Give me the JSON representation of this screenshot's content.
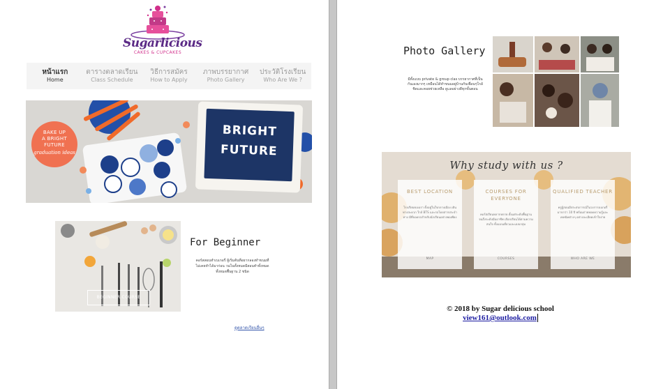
{
  "logo": {
    "word": "Sugarlicious",
    "tagline": "CAKES & CUPCAKES"
  },
  "nav": [
    {
      "th": "หน้าแรก",
      "en": "Home",
      "active": true
    },
    {
      "th": "ตารางตลาดเรียน",
      "en": "Class Schedule"
    },
    {
      "th": "วิธีการสมัคร",
      "en": "How to Apply"
    },
    {
      "th": "ภาพบรรยากาศ",
      "en": "Photo Gallery"
    },
    {
      "th": "ประวัติโรงเรียน",
      "en": "Who Are We ?"
    }
  ],
  "hero": {
    "bubble_line1": "BAKE UP",
    "bubble_line2": "A BRIGHT",
    "bubble_line3": "FUTURE",
    "bubble_script": "graduation ideas",
    "board_line1": "BRIGHT",
    "board_line2": "FUTURE"
  },
  "beginner": {
    "title": "For Beginner",
    "desc": "คอร์สสอนทำเบเกอรี่ ผู้เริ่มต้นที่อยากลองทำขนมที่ไม่เคยทำได้มาก่อน วนในทั้งหมดมีสอนทำทั้งหมดทั้งหมดพื้นฐาน 2 ชนิด",
    "button": "BEGINNER COURSE",
    "more_link": "ดูตลาดเรียนอื่นๆ"
  },
  "gallery": {
    "title": "Photo Gallery",
    "desc": "มีทั้งแบบ private & group clas บรรยากาศที่เป็นกันเองมากๆ เหมือนได้ทำขนมอยู่บ้านกับเพื่อนๆใกล้ชิดและคอยช่วยเหลือ ดูแลอย่างดีทุกขั้นตอน"
  },
  "why": {
    "title": "Why study with us ?",
    "cards": [
      {
        "title": "BEST LOCATION",
        "desc": "โรงเรียนของเรา ตั้งอยู่ในใจกลางเมือง เดินทางสะดวก ใกล้ BTS และรถโดยสารประจำทาง มีที่จอดรถสำหรับนักเรียนอย่างพอเพียง",
        "bottom": "MAP"
      },
      {
        "title": "COURSES FOR EVERYONE",
        "desc": "คอร์สเรียนหลากหลาย ตั้งแต่ระดับพื้นฐานจนถึงระดับมืออาชีพ เลือกเรียนได้ตามความสนใจ ทั้งแบบเดี่ยวและแบบกลุ่ม",
        "bottom": "COURSES"
      },
      {
        "title": "QUALIFIED TEACHER",
        "desc": "ครูผู้สอนมีประสบการณ์ในวงการเบเกอรี่มากกว่า 10 ปี พร้อมถ่ายทอดความรู้และเทคนิคต่างๆ อย่างละเอียดเข้าใจง่าย",
        "bottom": "WHO ARE WE"
      }
    ]
  },
  "footer": {
    "copyright": "© 2018 by Sugar delicious school",
    "email": "view161@outlook.com"
  }
}
